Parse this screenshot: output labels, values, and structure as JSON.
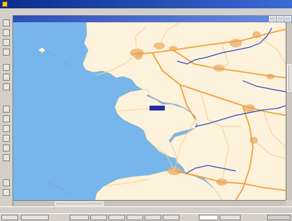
{
  "window": {
    "title": ""
  },
  "menu": [],
  "document": {
    "title": ""
  },
  "map": {
    "colors": {
      "sea": "#76b6ec",
      "land": "#fdf2dc",
      "river": "#2a46c8",
      "main_road": "#f2a037",
      "road": "#f7cf8a",
      "city": "#e8b070",
      "highlight": "#2b2b9c"
    },
    "icons": [
      "cursor-icon",
      "hand-icon",
      "zoom-in-icon",
      "zoom-out-icon",
      "route-icon",
      "measure-icon",
      "layers-icon",
      "print-icon"
    ]
  },
  "statusbar": {
    "text": ""
  },
  "taskbar": {
    "start_label": "",
    "items": [
      "",
      "",
      "",
      "",
      "",
      "",
      "",
      "",
      ""
    ]
  }
}
